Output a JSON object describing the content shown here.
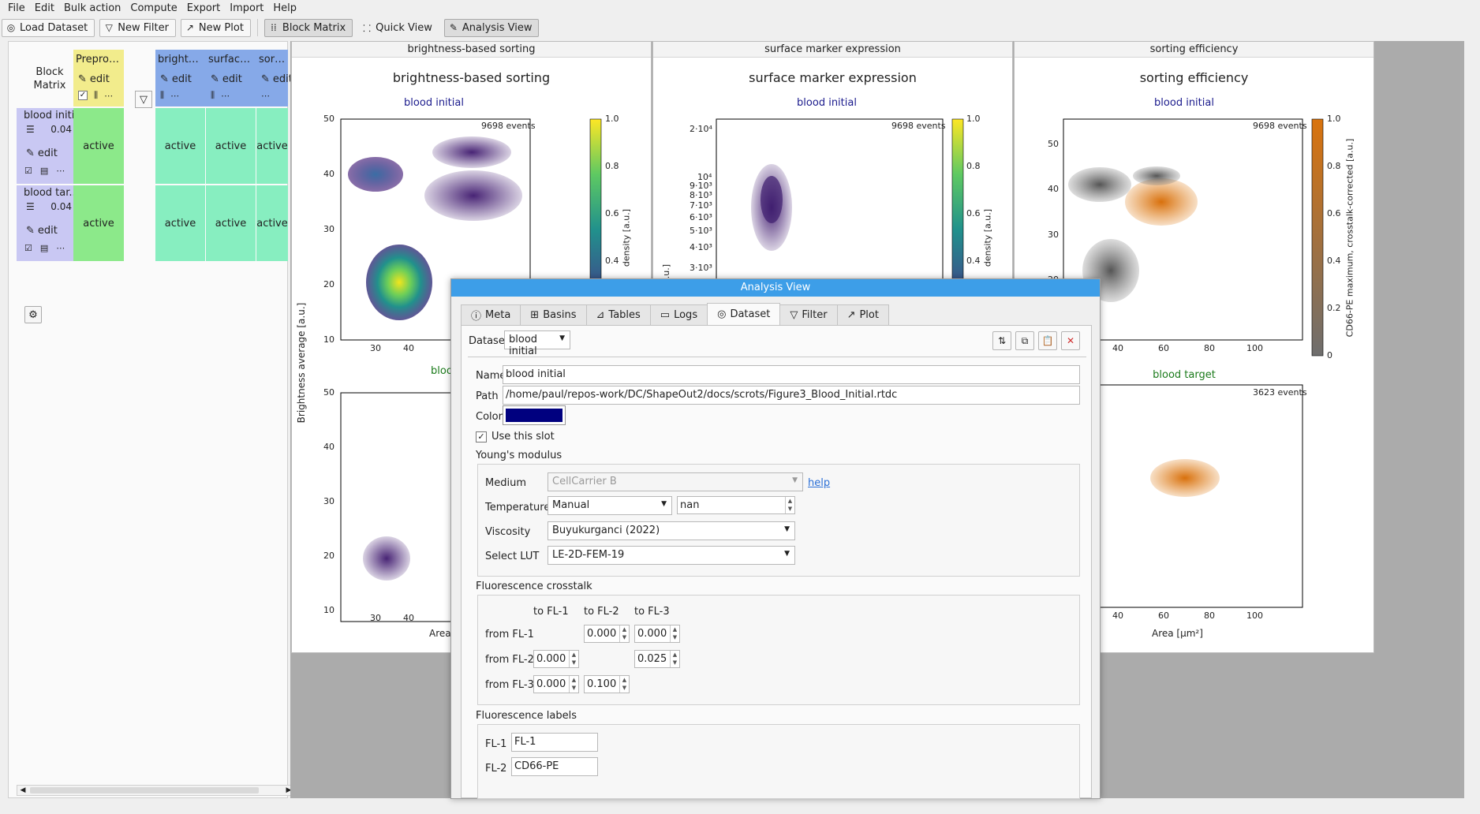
{
  "menu": [
    "File",
    "Edit",
    "Bulk action",
    "Compute",
    "Export",
    "Import",
    "Help"
  ],
  "toolbar": {
    "load_dataset": "Load Dataset",
    "new_filter": "New Filter",
    "new_plot": "New Plot",
    "block_matrix": "Block Matrix",
    "quick_view": "Quick View",
    "analysis_view": "Analysis View"
  },
  "block_matrix": {
    "title_line1": "Block",
    "title_line2": "Matrix",
    "edit_label": "edit",
    "columns": [
      {
        "label": "Preproce...",
        "kind": "preprocessing"
      },
      {
        "label": "brightne...",
        "kind": "filter"
      },
      {
        "label": "surface ...",
        "kind": "filter"
      },
      {
        "label": "sorting e",
        "kind": "filter"
      }
    ],
    "rows": [
      {
        "name": "blood initi...",
        "value": "0.04",
        "cells": [
          "active",
          "active",
          "active",
          "active"
        ]
      },
      {
        "name": "blood tar...",
        "value": "0.04",
        "cells": [
          "active",
          "active",
          "active",
          "active"
        ]
      }
    ]
  },
  "plots": [
    {
      "window_title": "brightness-based sorting",
      "title": "brightness-based sorting",
      "subplot_top": {
        "label": "blood initial",
        "events": "9698 events"
      },
      "subplot_bottom_label_partial": "bloo",
      "ylabel": "Brightness average [a.u.]",
      "xlabel_partial": "Area",
      "yticks": [
        "50",
        "40",
        "30",
        "20",
        "10"
      ],
      "xticks": [
        "30",
        "40"
      ],
      "colorbar_label": "density [a.u.]",
      "colorbar_ticks": [
        "1.0",
        "0.8",
        "0.6",
        "0.4"
      ]
    },
    {
      "window_title": "surface marker expression",
      "title": "surface marker expression",
      "subplot_top": {
        "label": "blood initial",
        "events": "9698 events"
      },
      "yticks": [
        "2·10⁴",
        "10⁴",
        "9·10³",
        "8·10³",
        "7·10³",
        "6·10³",
        "5·10³",
        "4·10³",
        "3·10³"
      ],
      "ylabel_partial": "a.u.]",
      "colorbar_label": "density [a.u.]",
      "colorbar_ticks": [
        "1.0",
        "0.8",
        "0.6",
        "0.4"
      ]
    },
    {
      "window_title": "sorting efficiency",
      "title": "sorting efficiency",
      "subplot_top": {
        "label": "blood initial",
        "events": "9698 events"
      },
      "subplot_bottom": {
        "label": "blood target",
        "events": "3623 events"
      },
      "xlabel": "Area [µm²]",
      "yticks": [
        "50",
        "40",
        "30",
        "20"
      ],
      "xticks": [
        "40",
        "60",
        "80",
        "100"
      ],
      "colorbar_label": "CD66-PE maximum, crosstalk-corrected [a.u.]",
      "colorbar_ticks": [
        "1.0",
        "0.8",
        "0.6",
        "0.4",
        "0.2",
        "0"
      ]
    }
  ],
  "dialog": {
    "title": "Analysis View",
    "tabs": [
      "Meta",
      "Basins",
      "Tables",
      "Logs",
      "Dataset",
      "Filter",
      "Plot"
    ],
    "active_tab": "Dataset",
    "dataset_label": "Dataset",
    "dataset_value": "blood initial",
    "name_label": "Name",
    "name_value": "blood initial",
    "path_label": "Path",
    "path_value": "/home/paul/repos-work/DC/ShapeOut2/docs/scrots/Figure3_Blood_Initial.rtdc",
    "color_label": "Color",
    "color_value": "#00007f",
    "use_slot_label": "Use this slot",
    "use_slot_checked": true,
    "youngs": {
      "heading": "Young's modulus",
      "medium_label": "Medium",
      "medium_value": "CellCarrier B",
      "help_link": "help",
      "temperature_label": "Temperature",
      "temperature_mode": "Manual",
      "temperature_value": "nan",
      "viscosity_label": "Viscosity",
      "viscosity_value": "Buyukurganci (2022)",
      "lut_label": "Select LUT",
      "lut_value": "LE-2D-FEM-19"
    },
    "crosstalk": {
      "heading": "Fluorescence crosstalk",
      "col_headers": [
        "to FL-1",
        "to FL-2",
        "to FL-3"
      ],
      "rows": [
        {
          "label": "from FL-1",
          "values": [
            "",
            "0.000",
            "0.000"
          ]
        },
        {
          "label": "from FL-2",
          "values": [
            "0.000",
            "",
            "0.025"
          ]
        },
        {
          "label": "from FL-3",
          "values": [
            "0.000",
            "0.100",
            ""
          ]
        }
      ]
    },
    "labels": {
      "heading": "Fluorescence labels",
      "items": [
        {
          "label": "FL-1",
          "value": "FL-1"
        },
        {
          "label": "FL-2",
          "value": "CD66-PE"
        }
      ]
    }
  }
}
